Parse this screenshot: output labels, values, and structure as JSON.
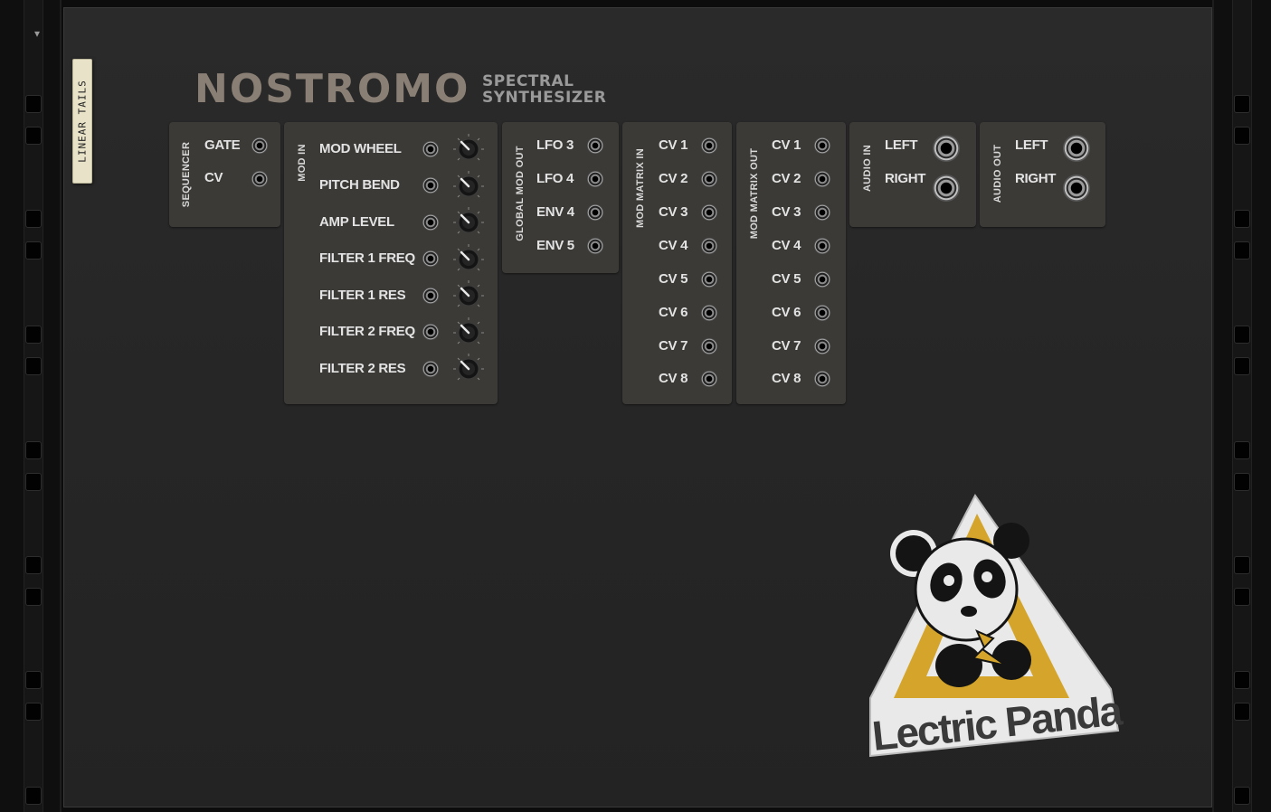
{
  "tape_label": "LINEAR TAILS",
  "device": {
    "title": "NOSTROMO",
    "subtitle_line1": "SPECTRAL",
    "subtitle_line2": "SYNTHESIZER"
  },
  "panels": {
    "sequencer": {
      "title": "SEQUENCER",
      "labels": [
        "GATE",
        "CV"
      ]
    },
    "mod_in": {
      "title": "MOD IN",
      "labels": [
        "MOD WHEEL",
        "PITCH BEND",
        "AMP LEVEL",
        "FILTER 1 FREQ",
        "FILTER 1 RES",
        "FILTER 2 FREQ",
        "FILTER 2 RES"
      ]
    },
    "global_mod_out": {
      "title": "GLOBAL MOD OUT",
      "labels": [
        "LFO 3",
        "LFO 4",
        "ENV 4",
        "ENV 5"
      ]
    },
    "mod_matrix_in": {
      "title": "MOD MATRIX IN",
      "labels": [
        "CV 1",
        "CV 2",
        "CV 3",
        "CV 4",
        "CV 5",
        "CV 6",
        "CV 7",
        "CV 8"
      ]
    },
    "mod_matrix_out": {
      "title": "MOD MATRIX OUT",
      "labels": [
        "CV 1",
        "CV 2",
        "CV 3",
        "CV 4",
        "CV 5",
        "CV 6",
        "CV 7",
        "CV 8"
      ]
    },
    "audio_in": {
      "title": "AUDIO IN",
      "labels": [
        "LEFT",
        "RIGHT"
      ]
    },
    "audio_out": {
      "title": "AUDIO OUT",
      "labels": [
        "LEFT",
        "RIGHT"
      ]
    }
  },
  "sticker": {
    "brand": "Lectric Panda"
  },
  "colors": {
    "panel": "#3b3a37",
    "logo": "#8a7f75",
    "sticker_yellow": "#d4a52a",
    "sticker_bg": "#e9e9e9",
    "tape": "#e7e2c8"
  }
}
